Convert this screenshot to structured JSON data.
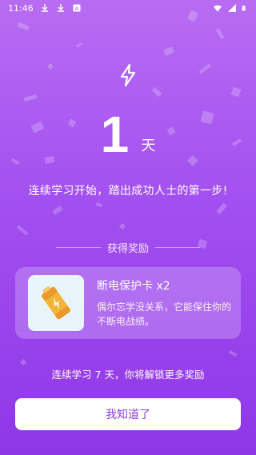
{
  "status_bar": {
    "time": "11:46",
    "left_icons": [
      "download-icon",
      "download-icon",
      "app-notification-icon"
    ],
    "right_icons": [
      "wifi-icon",
      "signal-icon",
      "battery-icon"
    ]
  },
  "streak": {
    "icon": "lightning-bolt-icon",
    "number": "1",
    "unit": "天",
    "message": "连续学习开始，踏出成功人士的第一步!"
  },
  "rewards_section": {
    "heading": "获得奖励",
    "card": {
      "image": "battery-power-card-icon",
      "title": "断电保护卡 x2",
      "description": "偶尔忘学没关系，它能保住你的不断电战绩。"
    }
  },
  "next_reward_text": "连续学习 7 天，你将解锁更多奖励",
  "confirm_button": "我知道了",
  "colors": {
    "background_top": "#b86cf2",
    "background_bottom": "#8f37e8",
    "button_text": "#8a3fe6",
    "card_bg": "rgba(255,255,255,0.22)"
  }
}
